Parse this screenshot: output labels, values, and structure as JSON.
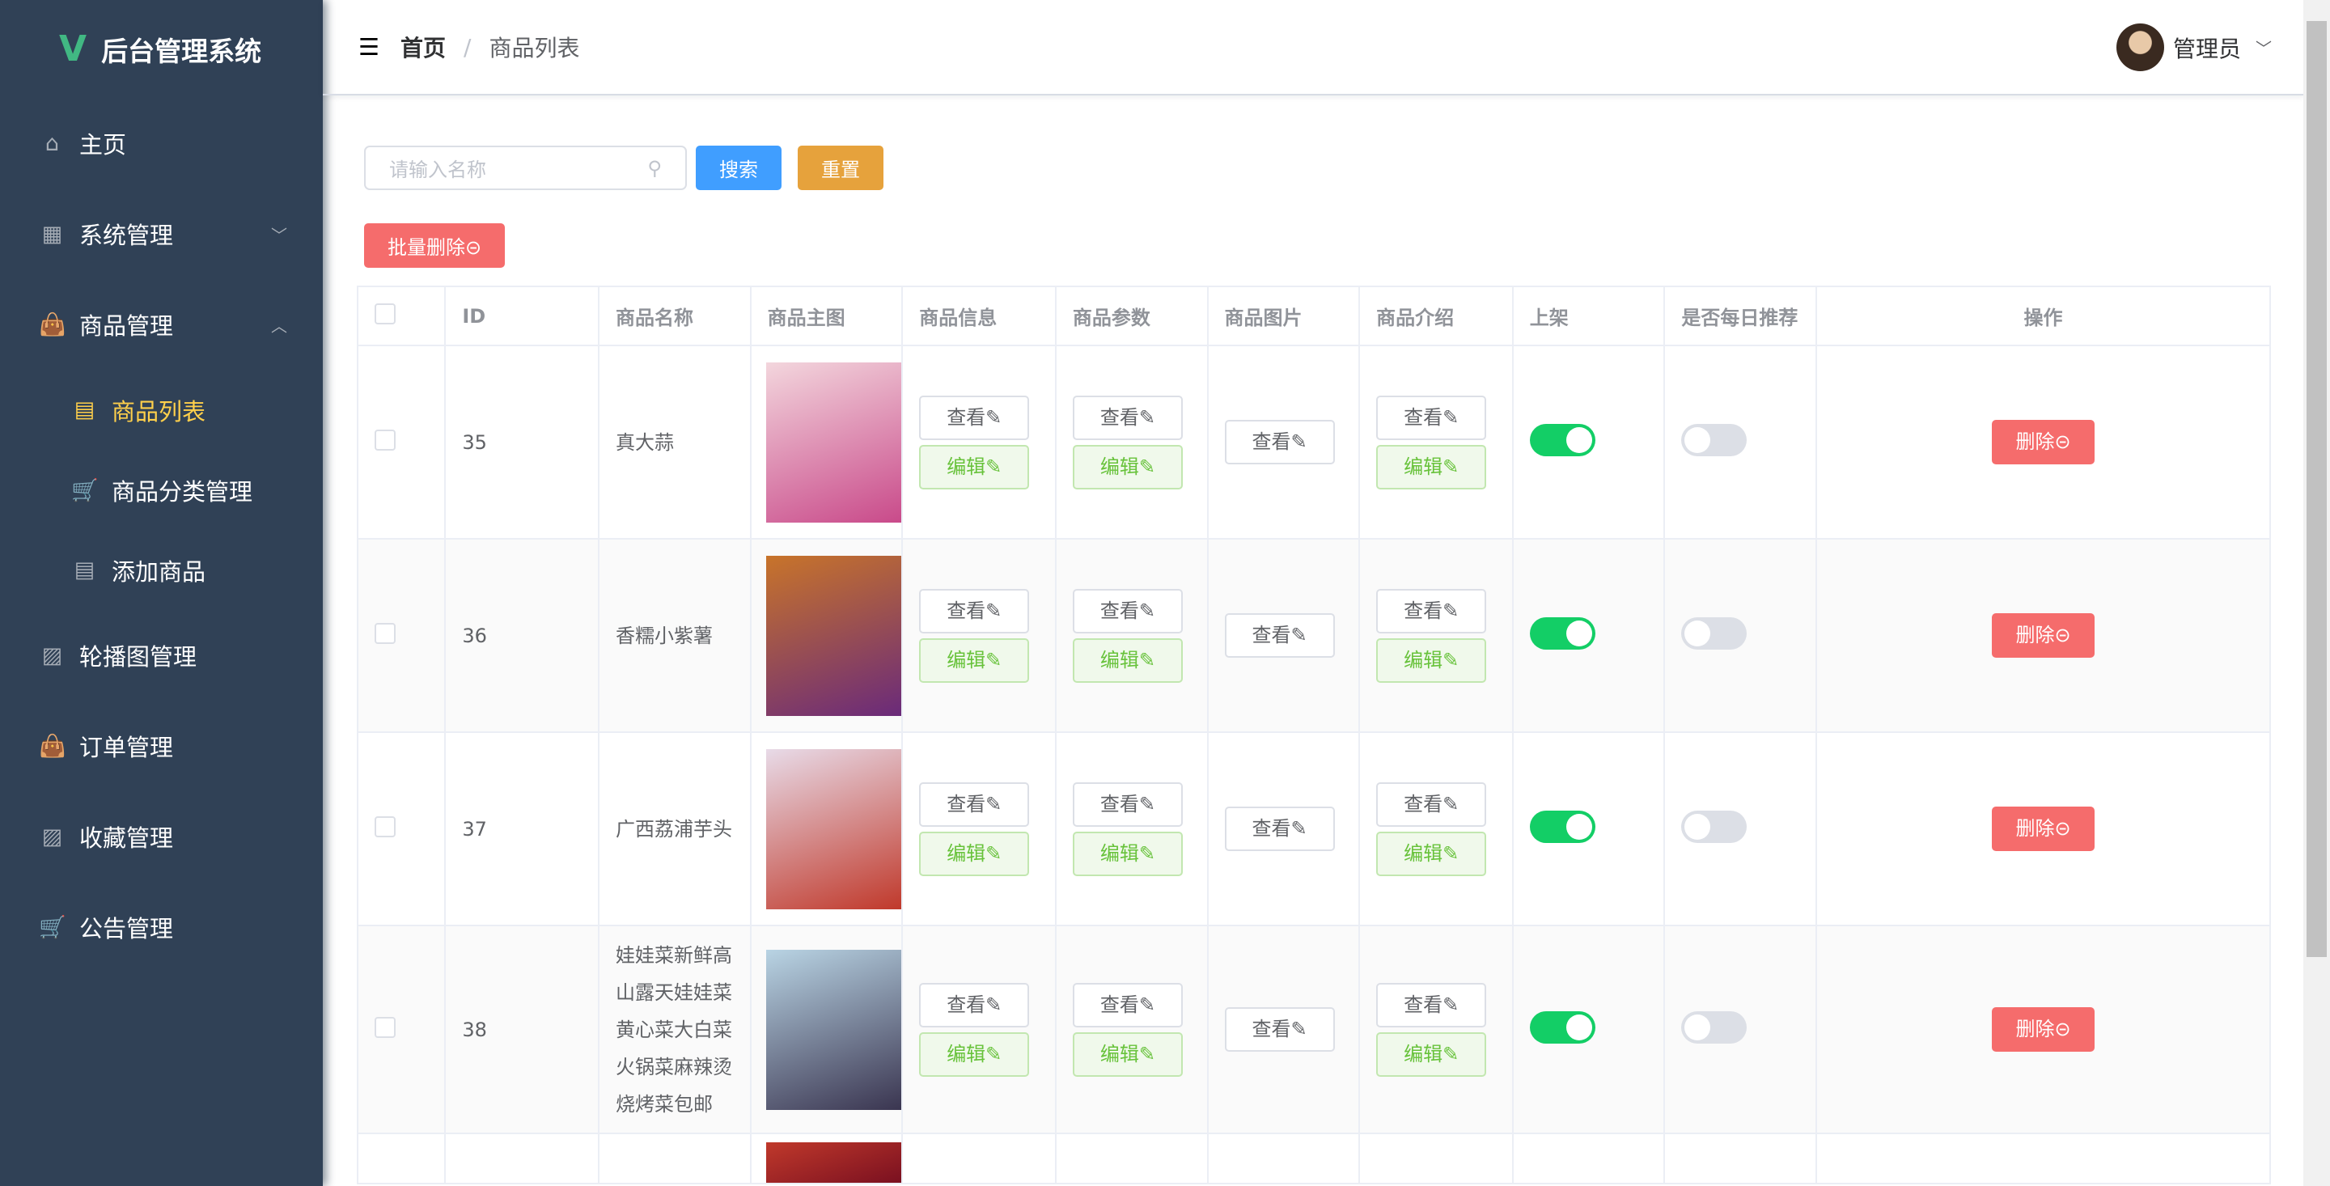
{
  "app": {
    "title": "后台管理系统",
    "logo": "V"
  },
  "sidebar": {
    "items": [
      {
        "label": "主页",
        "icon": "home-icon",
        "glyph": "⌂"
      },
      {
        "label": "系统管理",
        "icon": "grid-icon",
        "glyph": "▦",
        "arrow": "﹀"
      },
      {
        "label": "商品管理",
        "icon": "bag-icon",
        "glyph": "👜",
        "arrow": "︿"
      },
      {
        "label": "商品列表",
        "icon": "document-icon",
        "glyph": "▤",
        "sub": true,
        "active": true
      },
      {
        "label": "商品分类管理",
        "icon": "cart-icon",
        "glyph": "🛒",
        "sub": true
      },
      {
        "label": "添加商品",
        "icon": "document-icon",
        "glyph": "▤",
        "sub": true
      },
      {
        "label": "轮播图管理",
        "icon": "picture-icon",
        "glyph": "▨"
      },
      {
        "label": "订单管理",
        "icon": "bag-icon",
        "glyph": "👜"
      },
      {
        "label": "收藏管理",
        "icon": "picture-icon",
        "glyph": "▨"
      },
      {
        "label": "公告管理",
        "icon": "cart-icon",
        "glyph": "🛒"
      }
    ]
  },
  "header": {
    "breadcrumb_home": "首页",
    "breadcrumb_sep": "/",
    "breadcrumb_current": "商品列表",
    "user": "管理员"
  },
  "toolbar": {
    "search_placeholder": "请输入名称",
    "search_label": "搜索",
    "reset_label": "重置",
    "batch_delete_label": "批量删除⊝"
  },
  "table": {
    "headers": [
      "",
      "ID",
      "商品名称",
      "商品主图",
      "商品信息",
      "商品参数",
      "商品图片",
      "商品介绍",
      "上架",
      "是否每日推荐",
      "操作"
    ],
    "view_label": "查看✎",
    "edit_label": "编辑✎",
    "delete_label": "删除⊝",
    "rows": [
      {
        "id": "35",
        "name": "真大蒜",
        "img": [
          "#f3d6dd",
          "#c94a8a"
        ],
        "on_shelf": true,
        "daily": false
      },
      {
        "id": "36",
        "name": "香糯小紫薯",
        "img": [
          "#c8742a",
          "#6a2a7a"
        ],
        "on_shelf": true,
        "daily": false
      },
      {
        "id": "37",
        "name": "广西荔浦芋头",
        "img": [
          "#e8dbe8",
          "#c0392b"
        ],
        "on_shelf": true,
        "daily": false
      },
      {
        "id": "38",
        "name": "娃娃菜新鲜高山露天娃娃菜黄心菜大白菜火锅菜麻辣烫烧烤菜包邮",
        "img": [
          "#b9d4e4",
          "#3a3550"
        ],
        "on_shelf": true,
        "daily": false
      },
      {
        "id": "",
        "name": "",
        "img": [
          "#c0392b",
          "#7a1020"
        ],
        "on_shelf": null,
        "daily": null
      }
    ]
  }
}
